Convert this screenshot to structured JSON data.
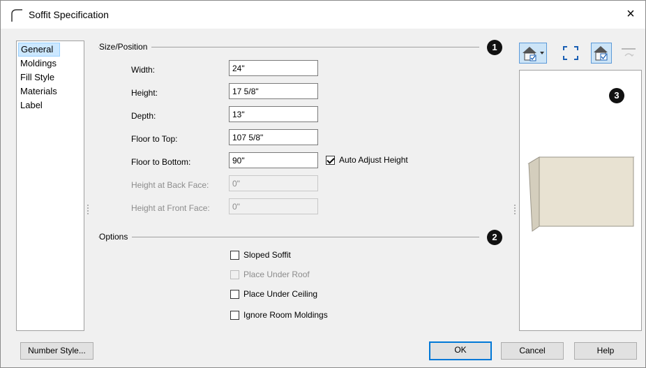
{
  "window": {
    "title": "Soffit Specification",
    "close_label": "×"
  },
  "nav": {
    "items": [
      "General",
      "Moldings",
      "Fill Style",
      "Materials",
      "Label"
    ],
    "selected": "General"
  },
  "size_position": {
    "group_label": "Size/Position",
    "badge": "1",
    "width_label": "Width:",
    "width_value": "24\"",
    "height_label": "Height:",
    "height_value": "17 5/8\"",
    "depth_label": "Depth:",
    "depth_value": "13\"",
    "floor_top_label": "Floor to Top:",
    "floor_top_value": "107 5/8\"",
    "floor_bottom_label": "Floor to Bottom:",
    "floor_bottom_value": "90\"",
    "auto_adjust_label": "Auto Adjust Height",
    "auto_adjust_checked": true,
    "back_face_label": "Height at Back Face:",
    "back_face_value": "0\"",
    "front_face_label": "Height at Front Face:",
    "front_face_value": "0\""
  },
  "options": {
    "group_label": "Options",
    "badge": "2",
    "sloped_soffit": "Sloped Soffit",
    "place_under_roof": "Place Under Roof",
    "place_under_ceiling": "Place Under Ceiling",
    "ignore_room_moldings": "Ignore Room Moldings"
  },
  "preview": {
    "badge": "3",
    "soffit_color": "#e8e2d2"
  },
  "buttons": {
    "number_style": "Number Style...",
    "ok": "OK",
    "cancel": "Cancel",
    "help": "Help"
  },
  "colors": {
    "selection": "#cce8ff",
    "default_button_border": "#0078d7"
  }
}
